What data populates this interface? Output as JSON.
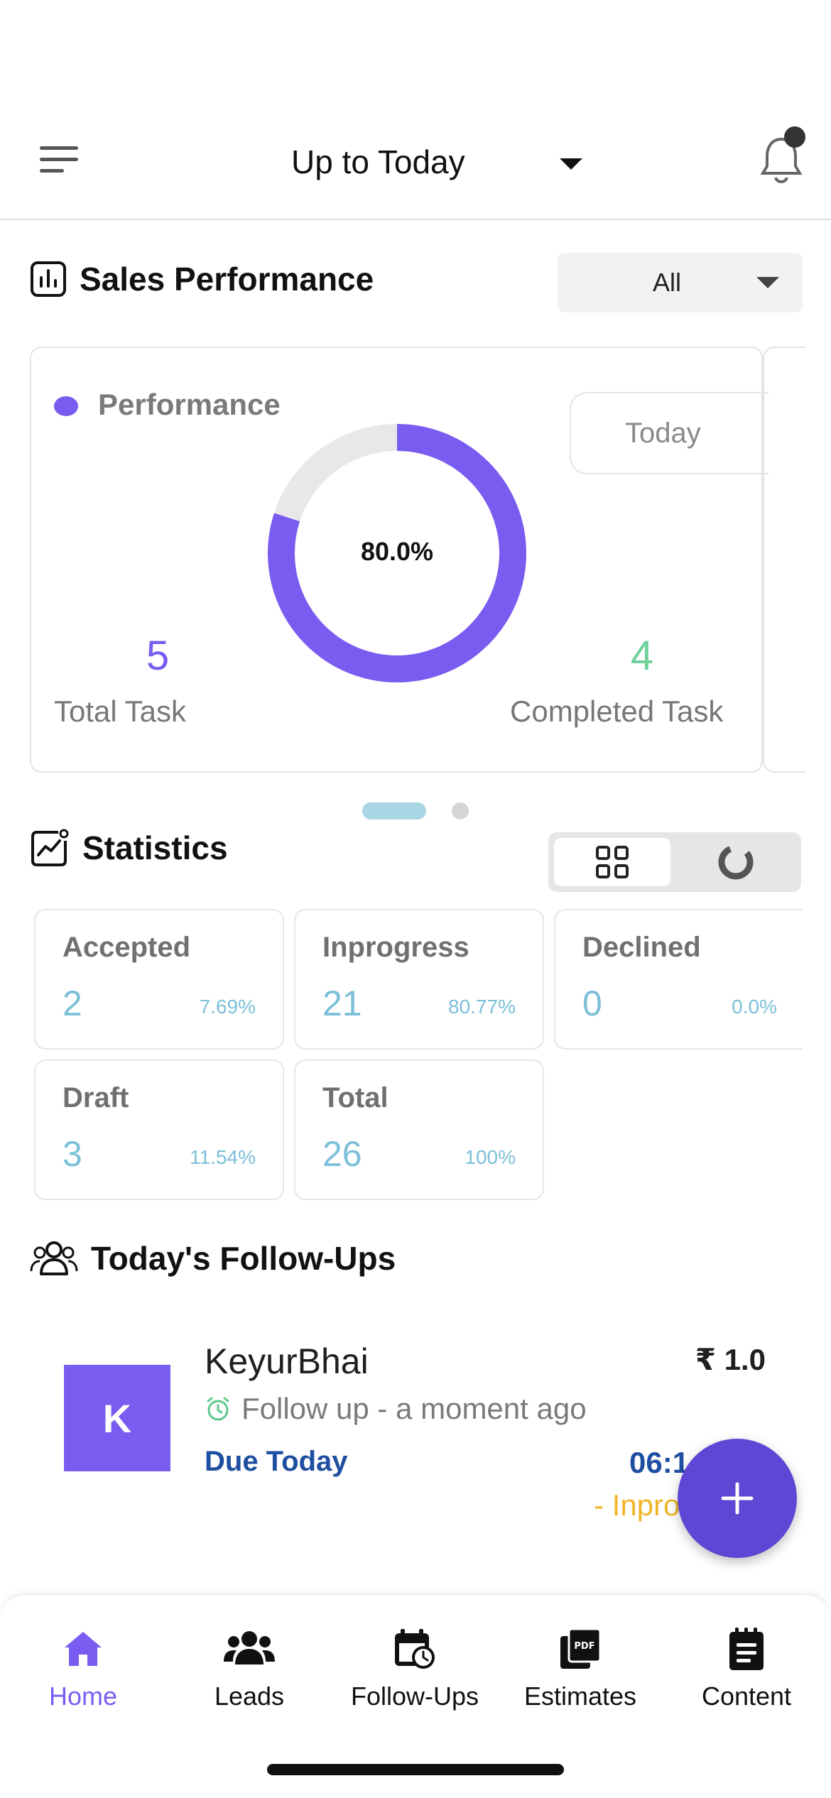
{
  "header": {
    "range_label": "Up to Today"
  },
  "sales_performance": {
    "title": "Sales Performance",
    "filter_value": "All",
    "card": {
      "legend_label": "Performance",
      "period_button": "Today",
      "percent_label": "80.0%",
      "percent_value": 80.0,
      "total_task_value": "5",
      "total_task_label": "Total Task",
      "completed_task_value": "4",
      "completed_task_label": "Completed Task"
    },
    "pager": {
      "pages": 2,
      "active": 0
    }
  },
  "statistics": {
    "title": "Statistics",
    "cards": [
      {
        "label": "Accepted",
        "value": "2",
        "pct": "7.69%"
      },
      {
        "label": "Inprogress",
        "value": "21",
        "pct": "80.77%"
      },
      {
        "label": "Declined",
        "value": "0",
        "pct": "0.0%"
      },
      {
        "label": "Draft",
        "value": "3",
        "pct": "11.54%"
      },
      {
        "label": "Total",
        "value": "26",
        "pct": "100%"
      }
    ]
  },
  "followups": {
    "title": "Today's Follow-Ups",
    "items": [
      {
        "avatar_letter": "K",
        "name": "KeyurBhai",
        "amount": "₹ 1.0",
        "subtitle": "Follow up - a moment ago",
        "due": "Due Today",
        "time": "06:1",
        "status": "- Inpro"
      }
    ]
  },
  "fab": {
    "icon": "plus-icon"
  },
  "nav": {
    "items": [
      {
        "label": "Home",
        "icon": "home-icon",
        "active": true
      },
      {
        "label": "Leads",
        "icon": "users-icon",
        "active": false
      },
      {
        "label": "Follow-Ups",
        "icon": "calendar-clock-icon",
        "active": false
      },
      {
        "label": "Estimates",
        "icon": "pdf-icon",
        "active": false
      },
      {
        "label": "Content",
        "icon": "notepad-icon",
        "active": false
      }
    ]
  },
  "colors": {
    "accent": "#7a5cf0",
    "fab": "#5d47d4",
    "completed": "#6fd19a",
    "stat_value": "#7cbfd8",
    "due": "#1f4fa0",
    "status": "#f0b429"
  }
}
